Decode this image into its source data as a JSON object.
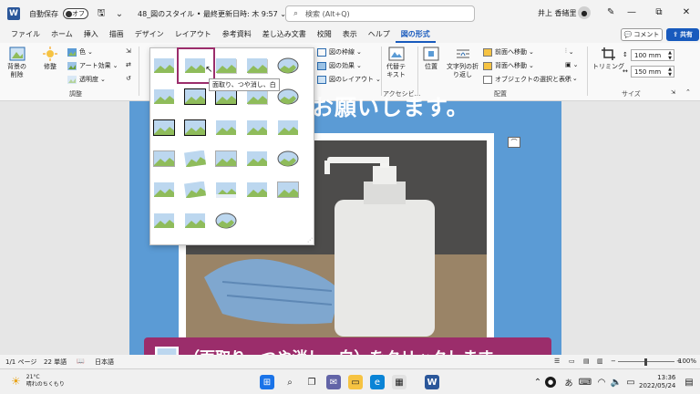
{
  "titlebar": {
    "app_icon": "W",
    "autosave_label": "自動保存",
    "toggle_state": "オフ",
    "document_title": "48_図のスタイル • 最終更新日時: 木 9:57 ⌄",
    "search_placeholder": "検索 (Alt+Q)",
    "user_name": "井上 香緒里",
    "window_buttons": [
      "—",
      "⧉",
      "✕"
    ]
  },
  "tabs": [
    "ファイル",
    "ホーム",
    "挿入",
    "描画",
    "デザイン",
    "レイアウト",
    "参考資料",
    "差し込み文書",
    "校閲",
    "表示",
    "ヘルプ",
    "図の形式"
  ],
  "active_tab": "図の形式",
  "buttons": {
    "comment": "コメント",
    "share": "共有"
  },
  "ribbon": {
    "remove_bg": "背景の\n削除",
    "corrections": "修整",
    "color": "色",
    "artistic": "アート効果",
    "transparency": "透明度",
    "group_adjust": "調整",
    "border": "図の枠線",
    "effects": "図の効果",
    "layout": "図のレイアウト",
    "alt_text": "代替テ\nキスト",
    "accessibility": "アクセシビ...",
    "position": "位置",
    "wrap_text": "文字列の折\nり返し",
    "bring_forward": "前面へ移動",
    "send_backward": "背面へ移動",
    "selection_pane": "オブジェクトの選択と表示",
    "group_arrange": "配置",
    "crop": "トリミング",
    "height": "100 mm",
    "width": "150 mm",
    "group_size": "サイズ"
  },
  "document": {
    "heading": "お願いします。"
  },
  "gallery": {
    "tooltip": "面取り、つや消し、白"
  },
  "caption": {
    "text": "（面取り、つや消し、白）をクリックします"
  },
  "statusbar": {
    "page": "1/1 ページ",
    "words": "22 単語",
    "language": "日本語",
    "zoom": "100%"
  },
  "taskbar": {
    "temperature": "21°C",
    "weather": "晴れのちくもり",
    "time": "13:36",
    "date": "2022/05/24",
    "language_indicator": "あ"
  },
  "colors": {
    "accent_blue": "#185abd",
    "caption_magenta": "#9b2d6b",
    "page_blue": "#5b9bd5"
  }
}
